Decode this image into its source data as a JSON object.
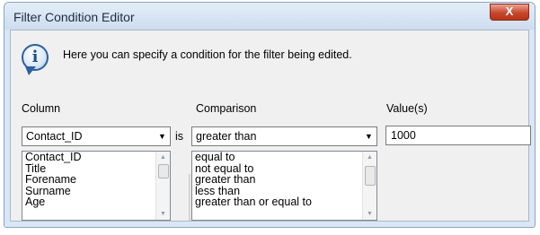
{
  "window": {
    "title": "Filter Condition Editor",
    "close_glyph": "X"
  },
  "info": {
    "icon": "info-icon",
    "glyph": "i",
    "text": "Here you can specify a condition for the filter being edited."
  },
  "column": {
    "label": "Column",
    "selected": "Contact_ID",
    "options": [
      "Contact_ID",
      "Title",
      "Forename",
      "Surname",
      "Age"
    ]
  },
  "is_label": "is",
  "comparison": {
    "label": "Comparison",
    "selected": "greater than",
    "options": [
      "equal to",
      "not equal to",
      "greater than",
      "less than",
      "greater than or equal to"
    ]
  },
  "values": {
    "label": "Value(s)",
    "value": "1000"
  }
}
